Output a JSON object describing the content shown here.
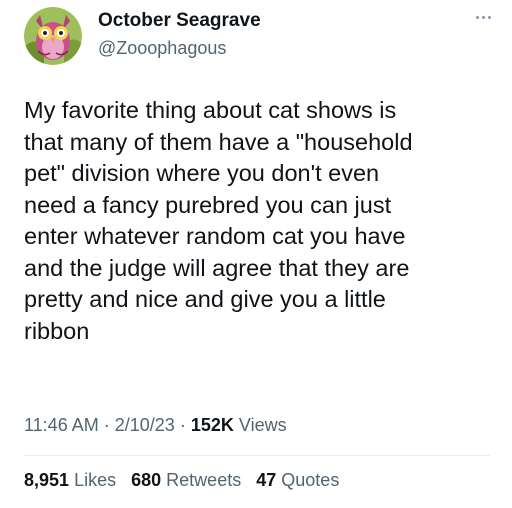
{
  "author": {
    "name": "October Seagrave",
    "handle": "@Zooophagous"
  },
  "tweet": {
    "lines": [
      "My favorite thing about cat shows is",
      "that many of them have a \"household",
      "pet\" division where you don't even",
      "need a fancy purebred you can just",
      "enter whatever random cat you have",
      "and the judge will agree that they are",
      "pretty and nice and give you a little",
      "ribbon"
    ],
    "time": "11:46 AM",
    "date": "2/10/23",
    "separator": "·",
    "views_count": "152K",
    "views_label": "Views"
  },
  "stats": {
    "likes_count": "8,951",
    "likes_label": "Likes",
    "retweets_count": "680",
    "retweets_label": "Retweets",
    "quotes_count": "47",
    "quotes_label": "Quotes"
  },
  "icons": {
    "avatar": "owl-avatar-icon",
    "more": "more-options-icon"
  },
  "colors": {
    "text": "#0f1419",
    "secondary": "#536471",
    "divider": "#e6ecf0"
  }
}
